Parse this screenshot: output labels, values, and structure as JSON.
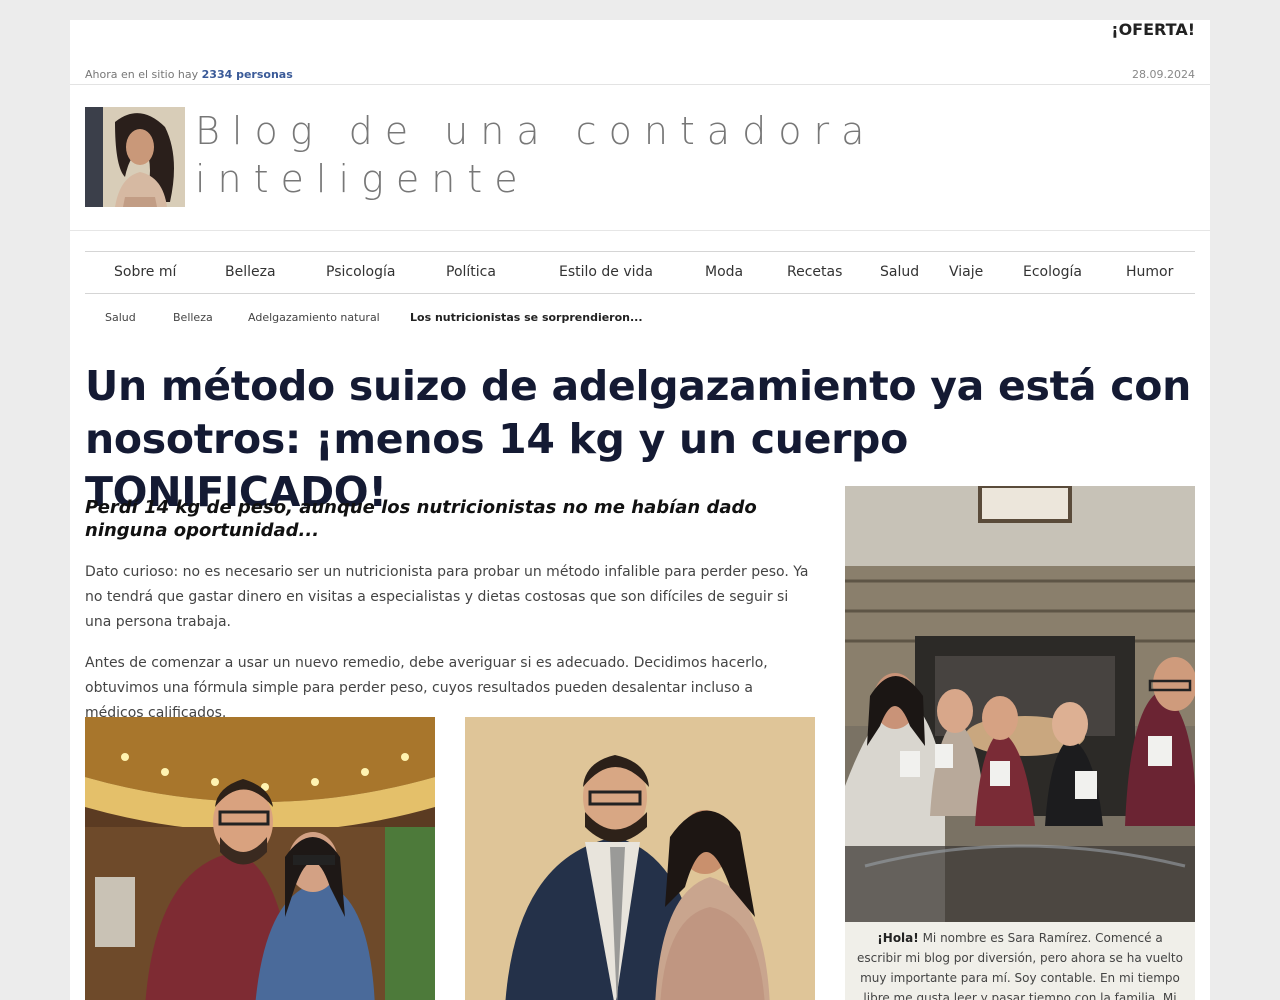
{
  "topbar": {
    "offer": "¡OFERTA!",
    "online_prefix": "Ahora en el sitio hay",
    "online_count": "2334 personas",
    "date": "28.09.2024"
  },
  "header": {
    "title": "Blog de una contadora inteligente"
  },
  "nav": {
    "items": [
      "Sobre mí",
      "Belleza",
      "Psicología",
      "Política",
      "Estilo de vida",
      "Moda",
      "Recetas",
      "Salud",
      "Viaje",
      "Ecología",
      "Humor"
    ]
  },
  "breadcrumb": {
    "items": [
      "Salud",
      "Belleza",
      "Adelgazamiento natural",
      "Los nutricionistas se sorprendieron..."
    ]
  },
  "article": {
    "headline": "Un método suizo de adelgazamiento ya está con nosotros: ¡menos 14 kg y un cuerpo TONIFICADO!",
    "subhead": "Perdí 14 kg de peso, aunque los nutricionistas no me habían dado ninguna oportunidad...",
    "p1": "Dato curioso: no es necesario ser un nutricionista para probar un método infalible para perder peso. Ya no tendrá que gastar dinero en visitas a especialistas y dietas costosas que son difíciles de seguir si una persona trabaja.",
    "p2": "Antes de comenzar a usar un nuevo remedio, debe averiguar si es adecuado. Decidimos hacerlo, obtuvimos una fórmula simple para perder peso, cuyos resultados pueden desalentar incluso a médicos calificados."
  },
  "sidebar": {
    "bio_greeting": "¡Hola!",
    "bio_text": "Mi nombre es Sara Ramírez. Comencé a escribir mi blog por diversión, pero ahora se ha vuelto muy importante para mí. Soy contable. En mi tiempo libre me gusta leer y pasar tiempo con la familia. Mi libro favorito es \"El nombre"
  },
  "colors": {
    "headline": "#141a33",
    "online_count": "#3a5a98",
    "bio_bg": "#f0efe9"
  }
}
